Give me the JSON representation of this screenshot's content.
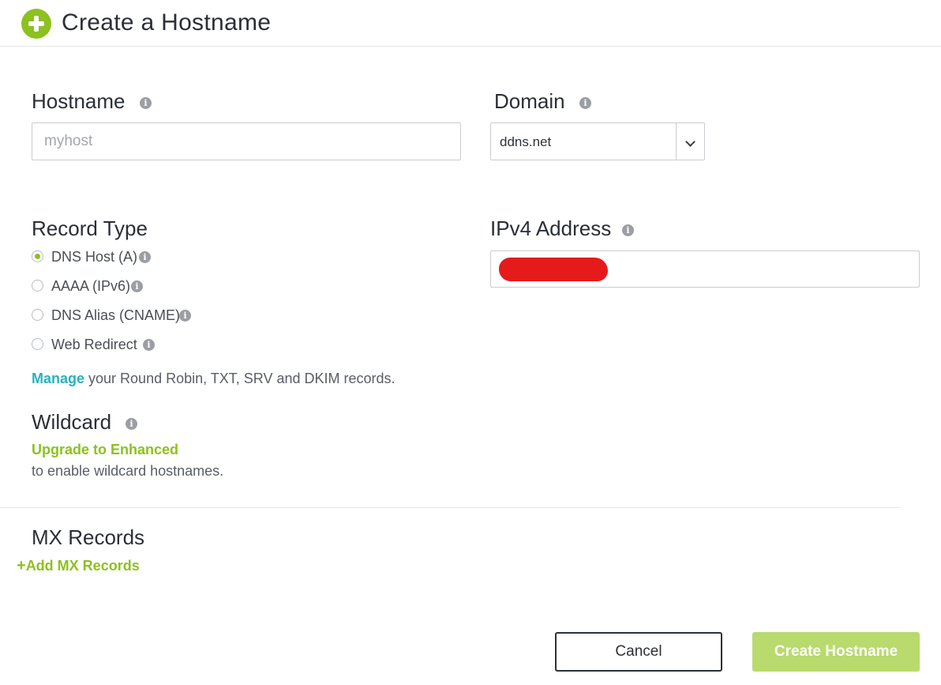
{
  "header": {
    "icon": "plus-circle-icon",
    "title": "Create a Hostname"
  },
  "hostname": {
    "label": "Hostname",
    "placeholder": "myhost",
    "value": ""
  },
  "domain": {
    "label": "Domain",
    "selected": "ddns.net"
  },
  "record_type": {
    "label": "Record Type",
    "options": [
      {
        "label": "DNS Host (A)",
        "checked": true
      },
      {
        "label": "AAAA (IPv6)",
        "checked": false
      },
      {
        "label": "DNS Alias (CNAME)",
        "checked": false
      },
      {
        "label": "Web Redirect",
        "checked": false
      }
    ],
    "manage_link": "Manage",
    "manage_text": " your Round Robin, TXT, SRV and DKIM records."
  },
  "ipv4": {
    "label": "IPv4 Address"
  },
  "wildcard": {
    "label": "Wildcard",
    "upgrade_link": "Upgrade to Enhanced",
    "note": "to enable wildcard hostnames."
  },
  "mx": {
    "label": "MX Records",
    "add_link": "Add MX Records"
  },
  "actions": {
    "cancel": "Cancel",
    "create": "Create Hostname"
  },
  "colors": {
    "accent_green": "#8cc11f",
    "link_teal": "#26b3bd",
    "create_button": "#b9da6d",
    "redaction": "#e51b1b"
  }
}
